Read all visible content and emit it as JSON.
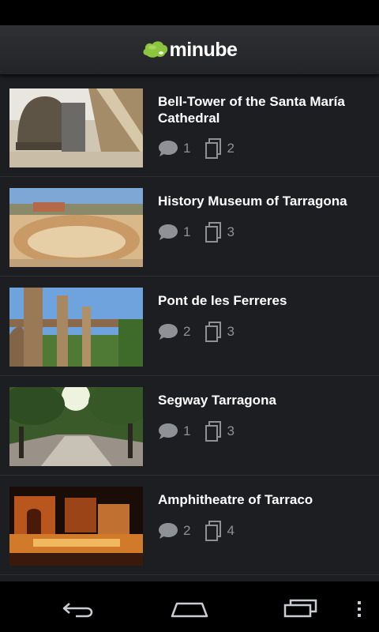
{
  "app": {
    "brand_name": "minube",
    "brand_color": "#8cc63f"
  },
  "places": [
    {
      "title": "Bell-Tower of the Santa María Cathedral",
      "comments": "1",
      "photos": "2"
    },
    {
      "title": "History Museum of Tarragona",
      "comments": "1",
      "photos": "3"
    },
    {
      "title": "Pont de les Ferreres",
      "comments": "2",
      "photos": "3"
    },
    {
      "title": "Segway Tarragona",
      "comments": "1",
      "photos": "3"
    },
    {
      "title": "Amphitheatre of Tarraco",
      "comments": "2",
      "photos": "4"
    }
  ],
  "icons": {
    "comment": "speech-bubble-icon",
    "photos": "stacked-photos-icon",
    "back": "back-arrow-icon",
    "home": "home-icon",
    "recents": "recent-apps-icon",
    "menu": "overflow-menu-icon"
  }
}
